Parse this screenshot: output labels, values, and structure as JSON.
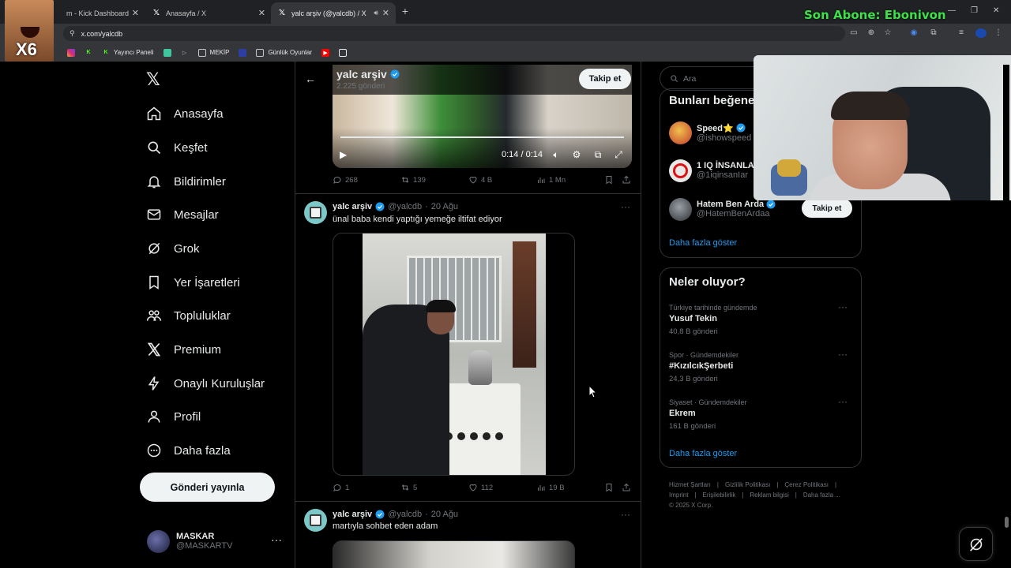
{
  "browser": {
    "tabs": [
      {
        "title": "m - Kick Dashboard",
        "icon": "kick-icon"
      },
      {
        "title": "Anasayfa / X",
        "icon": "x-icon"
      },
      {
        "title": "yalc arşiv (@yalcdb) / X",
        "icon": "x-icon",
        "active": true
      }
    ],
    "url": "x.com/yalcdb",
    "bookmarks": [
      {
        "label": "",
        "icon": "x-icon"
      },
      {
        "label": "",
        "icon": "instagram-icon"
      },
      {
        "label": "",
        "icon": "kick-icon"
      },
      {
        "label": "Yayıncı Paneli",
        "icon": "kick-icon"
      },
      {
        "label": "",
        "icon": "app-icon"
      },
      {
        "label": "",
        "icon": "arrow-icon"
      },
      {
        "label": "MEKİP",
        "icon": "folder-icon"
      },
      {
        "label": "",
        "icon": "app-icon"
      },
      {
        "label": "Günlük Oyunlar",
        "icon": "folder-icon"
      },
      {
        "label": "",
        "icon": "youtube-icon"
      },
      {
        "label": "",
        "icon": "app-icon"
      }
    ]
  },
  "stream": {
    "banner": "Son Abone: Ebonivon",
    "multiplier": "X6"
  },
  "nav": {
    "items": [
      {
        "label": "Anasayfa",
        "icon": "home-icon"
      },
      {
        "label": "Keşfet",
        "icon": "search-icon"
      },
      {
        "label": "Bildirimler",
        "icon": "bell-icon"
      },
      {
        "label": "Mesajlar",
        "icon": "mail-icon"
      },
      {
        "label": "Grok",
        "icon": "grok-icon"
      },
      {
        "label": "Yer İşaretleri",
        "icon": "bookmark-icon"
      },
      {
        "label": "Topluluklar",
        "icon": "communities-icon"
      },
      {
        "label": "Premium",
        "icon": "x-icon"
      },
      {
        "label": "Onaylı Kuruluşlar",
        "icon": "lightning-icon"
      },
      {
        "label": "Profil",
        "icon": "person-icon"
      },
      {
        "label": "Daha fazla",
        "icon": "more-circle-icon"
      }
    ],
    "post_button": "Gönderi yayınla",
    "account": {
      "name": "MASKAR",
      "handle": "@MASKARTV"
    }
  },
  "profile_header": {
    "name": "yalc arşiv",
    "post_count": "2.225 gönderi",
    "follow_label": "Takip et"
  },
  "timeline": {
    "video_time": "0:14 / 0:14",
    "first_post_actions": {
      "replies": "268",
      "reposts": "139",
      "likes": "4 B",
      "views": "1 Mn"
    },
    "posts": [
      {
        "name": "yalc arşiv",
        "handle": "@yalcdb",
        "date": "20 Ağu",
        "text": "ünal baba kendi yaptığı yemeğe iltifat ediyor",
        "actions": {
          "replies": "1",
          "reposts": "5",
          "likes": "112",
          "views": "19 B"
        }
      },
      {
        "name": "yalc arşiv",
        "handle": "@yalcdb",
        "date": "20 Ağu",
        "text": "martıyla sohbet eden adam"
      }
    ]
  },
  "sidebar": {
    "search_placeholder": "Ara",
    "who_to_follow": {
      "title": "Bunları beğene",
      "accounts": [
        {
          "name": "Speed⭐",
          "handle": "@ishowspeed",
          "avatar_color": "#c0392b"
        },
        {
          "name": "1 IQ İNSANLA",
          "handle": "@1iqinsanIar",
          "avatar_color": "#e8e8e8"
        },
        {
          "name": "Hatem Ben Arda",
          "handle": "@HatemBenArdaa",
          "avatar_color": "#555a60",
          "follow_label": "Takip et"
        }
      ],
      "show_more": "Daha fazla göster"
    },
    "trends": {
      "title": "Neler oluyor?",
      "items": [
        {
          "meta": "Türkiye tarihinde gündemde",
          "title": "Yusuf Tekin",
          "count": "40,8 B gönderi"
        },
        {
          "meta": "Spor · Gündemdekiler",
          "title": "#KızılcıkŞerbeti",
          "count": "24,3 B gönderi"
        },
        {
          "meta": "Siyaset · Gündemdekiler",
          "title": "Ekrem",
          "count": "161 B gönderi"
        }
      ],
      "show_more": "Daha fazla göster"
    },
    "footer": {
      "links": [
        "Hizmet Şartları",
        "Gizlilik Politikası",
        "Çerez Politikası",
        "Imprint",
        "Erişilebilirlik",
        "Reklam bilgisi",
        "Daha fazla ..."
      ],
      "copyright": "© 2025 X Corp."
    }
  },
  "colors": {
    "accent": "#1d9bf0",
    "verified": "#1d9bf0",
    "background": "#000000",
    "border": "#2f3336"
  }
}
